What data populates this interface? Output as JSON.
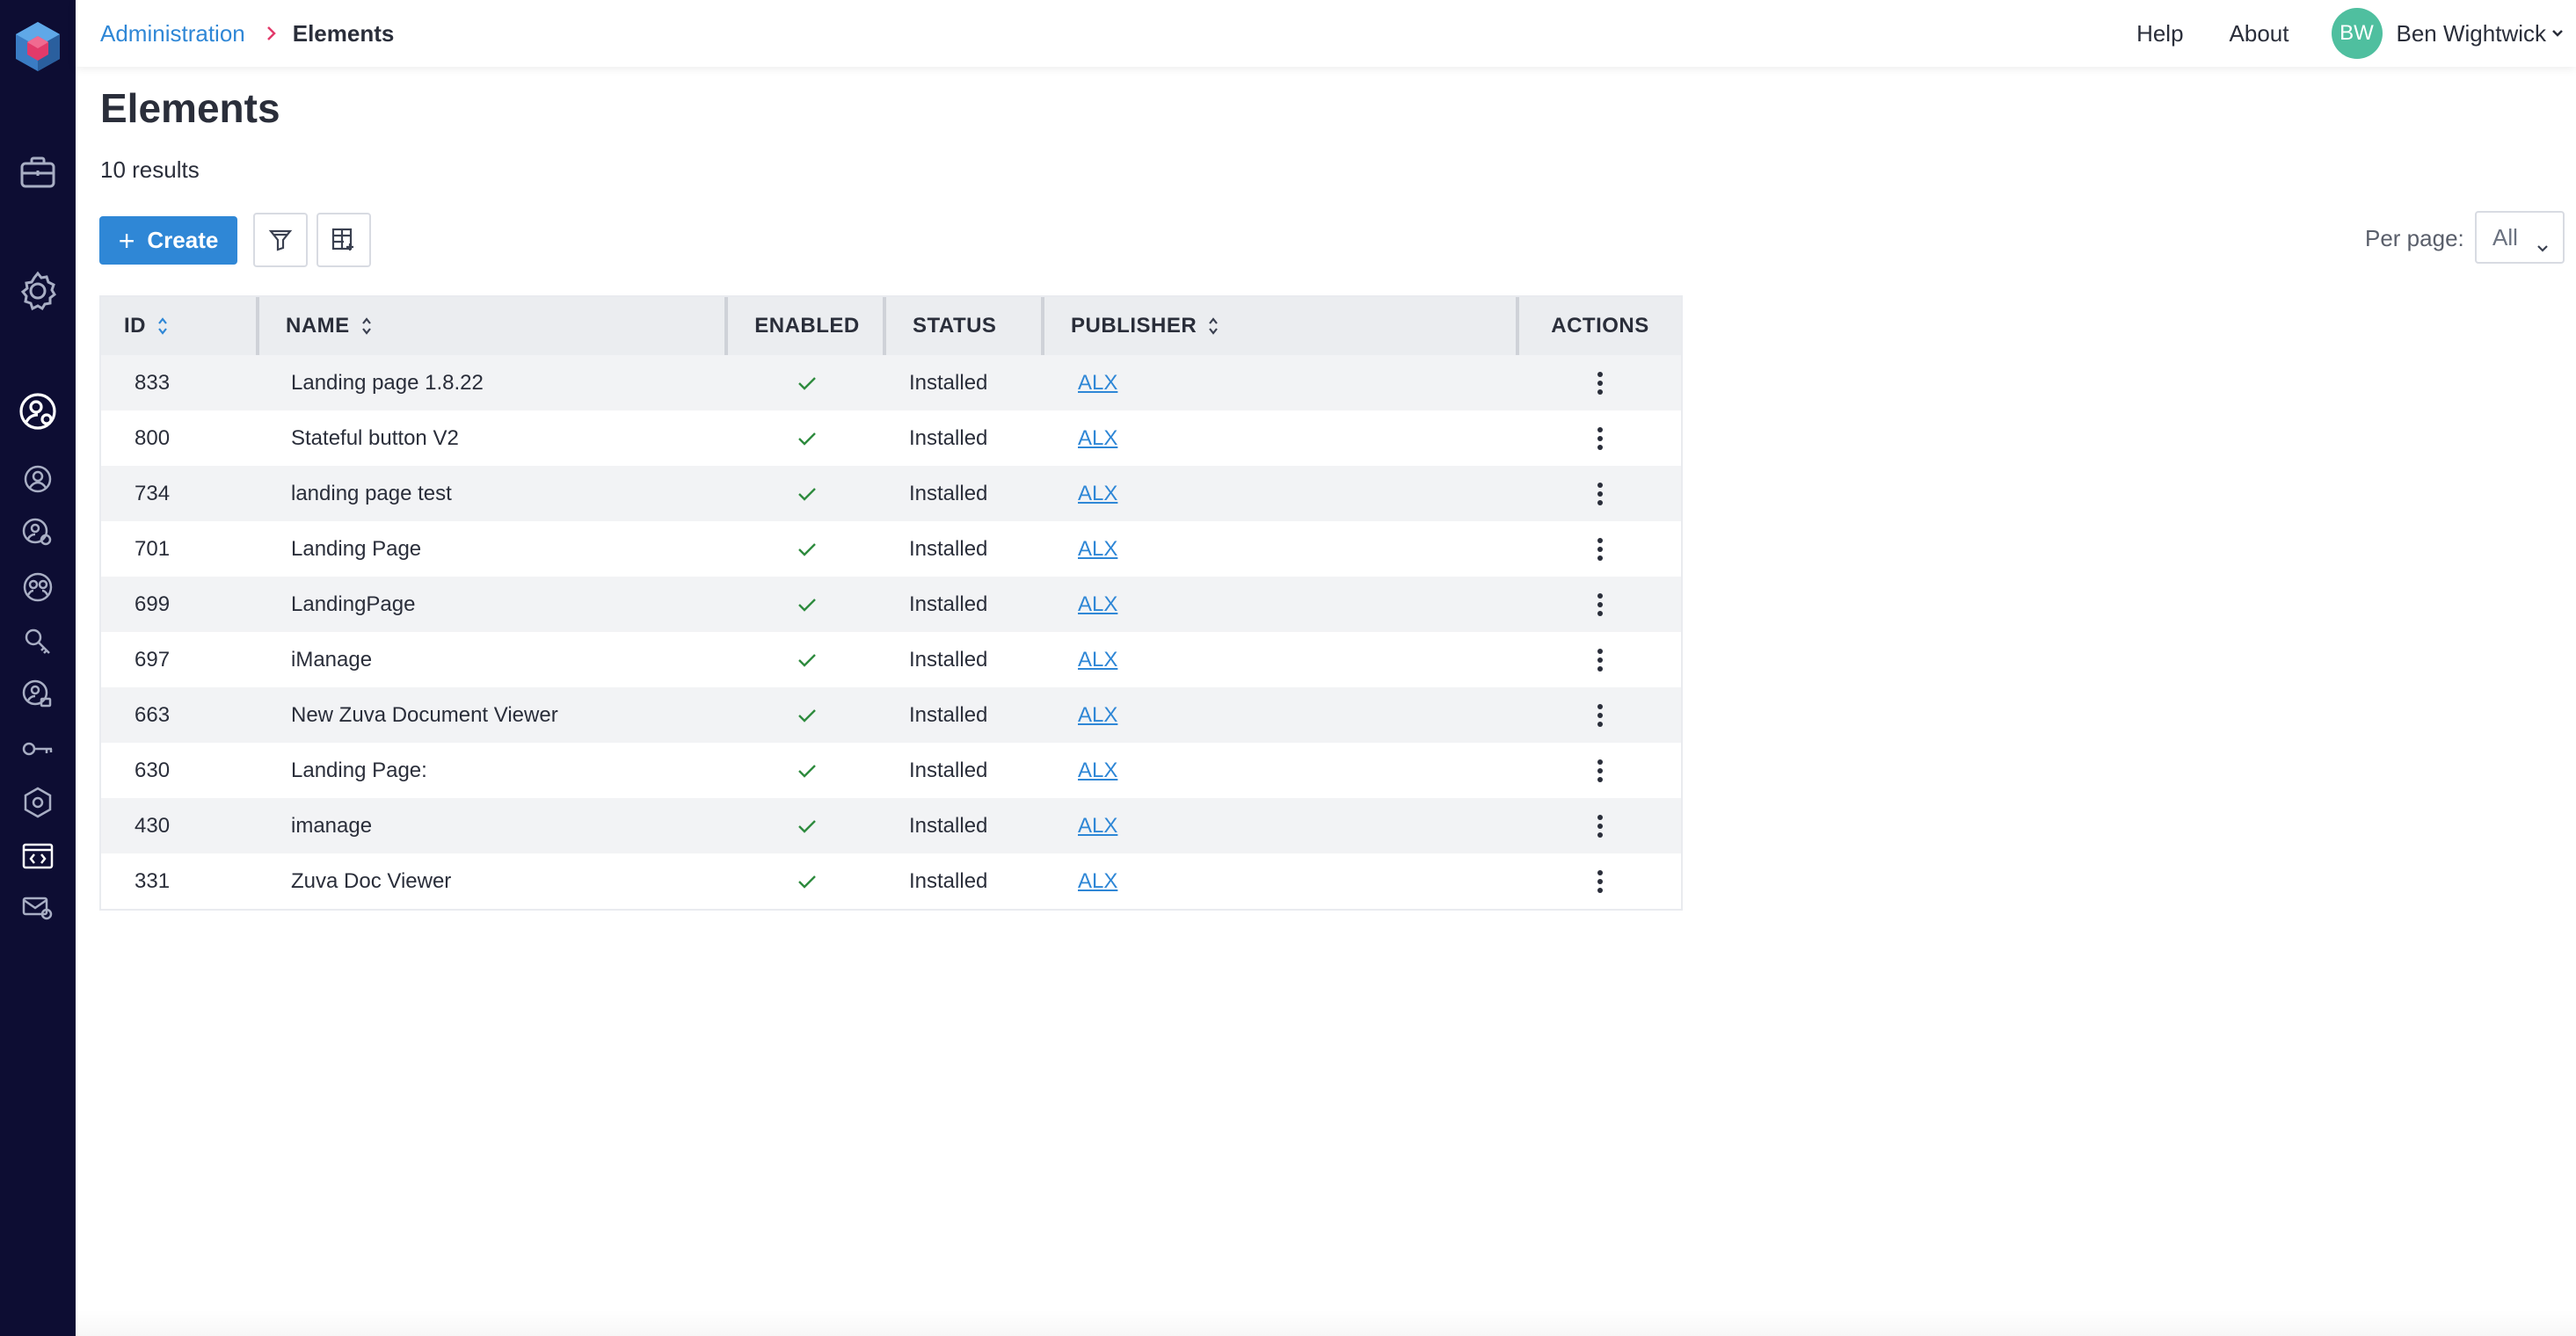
{
  "breadcrumb": {
    "parent": "Administration",
    "current": "Elements"
  },
  "header": {
    "help": "Help",
    "about": "About",
    "user_initials": "BW",
    "user_name": "Ben Wightwick"
  },
  "page": {
    "title": "Elements",
    "results": "10 results"
  },
  "toolbar": {
    "create_label": "Create",
    "per_page_label": "Per page:",
    "per_page_value": "All"
  },
  "table": {
    "columns": {
      "id": "ID",
      "name": "NAME",
      "enabled": "ENABLED",
      "status": "STATUS",
      "publisher": "PUBLISHER",
      "actions": "ACTIONS"
    },
    "rows": [
      {
        "id": "833",
        "name": "Landing page 1.8.22",
        "status": "Installed",
        "publisher": "ALX"
      },
      {
        "id": "800",
        "name": "Stateful button V2",
        "status": "Installed",
        "publisher": "ALX"
      },
      {
        "id": "734",
        "name": "landing page test",
        "status": "Installed",
        "publisher": "ALX"
      },
      {
        "id": "701",
        "name": "Landing Page",
        "status": "Installed",
        "publisher": "ALX"
      },
      {
        "id": "699",
        "name": "LandingPage",
        "status": "Installed",
        "publisher": "ALX"
      },
      {
        "id": "697",
        "name": "iManage",
        "status": "Installed",
        "publisher": "ALX"
      },
      {
        "id": "663",
        "name": "New Zuva Document Viewer",
        "status": "Installed",
        "publisher": "ALX"
      },
      {
        "id": "630",
        "name": "Landing Page:",
        "status": "Installed",
        "publisher": "ALX"
      },
      {
        "id": "430",
        "name": "imanage",
        "status": "Installed",
        "publisher": "ALX"
      },
      {
        "id": "331",
        "name": "Zuva Doc Viewer",
        "status": "Installed",
        "publisher": "ALX"
      }
    ]
  },
  "colors": {
    "sidebar": "#0d0d33",
    "accent": "#2f87d6",
    "avatar": "#4fbf9f",
    "check": "#2e8b3e"
  },
  "icons": {
    "sidebar": [
      "logo-icon",
      "briefcase-icon",
      "settings-gear-icon",
      "user-admin-icon",
      "user-icon",
      "user-settings-icon",
      "users-group-icon",
      "key-search-icon",
      "user-lock-icon",
      "key-icon",
      "hexagon-settings-icon",
      "code-window-icon",
      "mail-settings-icon"
    ]
  }
}
